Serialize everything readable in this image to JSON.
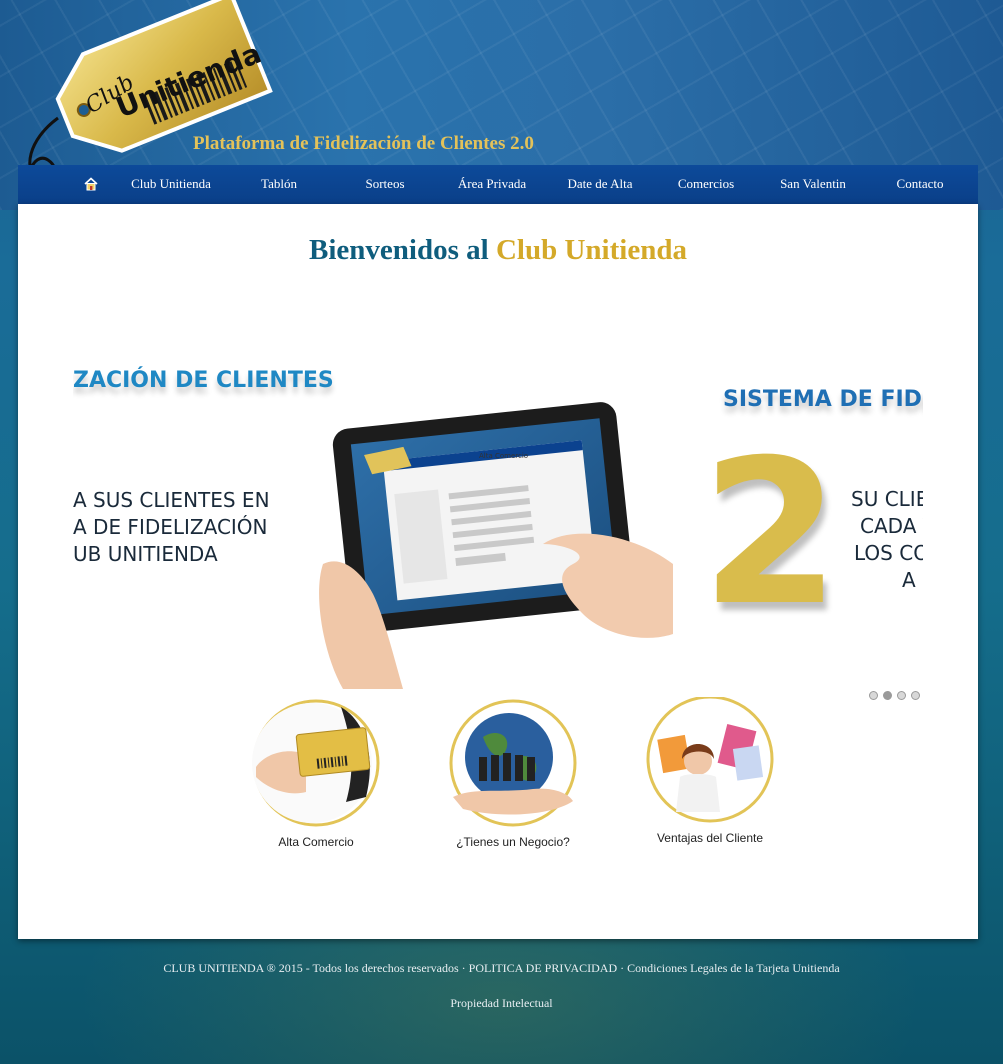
{
  "header": {
    "logo_text_club": "Club",
    "logo_text_brand": "Unitienda",
    "tagline": "Plataforma de Fidelización de Clientes 2.0"
  },
  "nav": {
    "home_icon": "home-icon",
    "items": [
      {
        "label": "Club Unitienda"
      },
      {
        "label": "Tablón"
      },
      {
        "label": "Sorteos"
      },
      {
        "label": "Área Privada"
      },
      {
        "label": "Date de Alta"
      },
      {
        "label": "Comercios"
      },
      {
        "label": "San Valentin"
      },
      {
        "label": "Contacto"
      }
    ]
  },
  "main": {
    "welcome_part1": "Bienvenidos al",
    "welcome_part2": "Club Unitienda",
    "slider": {
      "left_heading": "ZACIÓN DE CLIENTES",
      "left_lines": [
        "A SUS CLIENTES EN",
        "A DE FIDELIZACIÓN",
        "UB UNITIENDA"
      ],
      "right_heading": "SISTEMA DE FIDELI",
      "big_number": "2",
      "right_lines": [
        "SU CLIE",
        "CADA V",
        "LOS CO",
        "A C"
      ],
      "tablet_screen_title": "Alta Comercio",
      "active_slide": 2,
      "slide_count": 4
    },
    "features": [
      {
        "label": "Alta Comercio"
      },
      {
        "label": "¿Tienes un Negocio?"
      },
      {
        "label": "Ventajas del Cliente"
      }
    ]
  },
  "footer": {
    "copyright": "CLUB UNITIENDA ® 2015 - Todos los derechos reservados",
    "sep": "·",
    "privacy": "POLITICA DE PRIVACIDAD",
    "legal": "Condiciones Legales de la Tarjeta Unitienda",
    "ip": "Propiedad Intelectual"
  },
  "colors": {
    "nav_bg": "#0b428f",
    "accent_gold": "#d4a929",
    "title_teal": "#0f5d7d",
    "slide_blue": "#1f88c4"
  }
}
